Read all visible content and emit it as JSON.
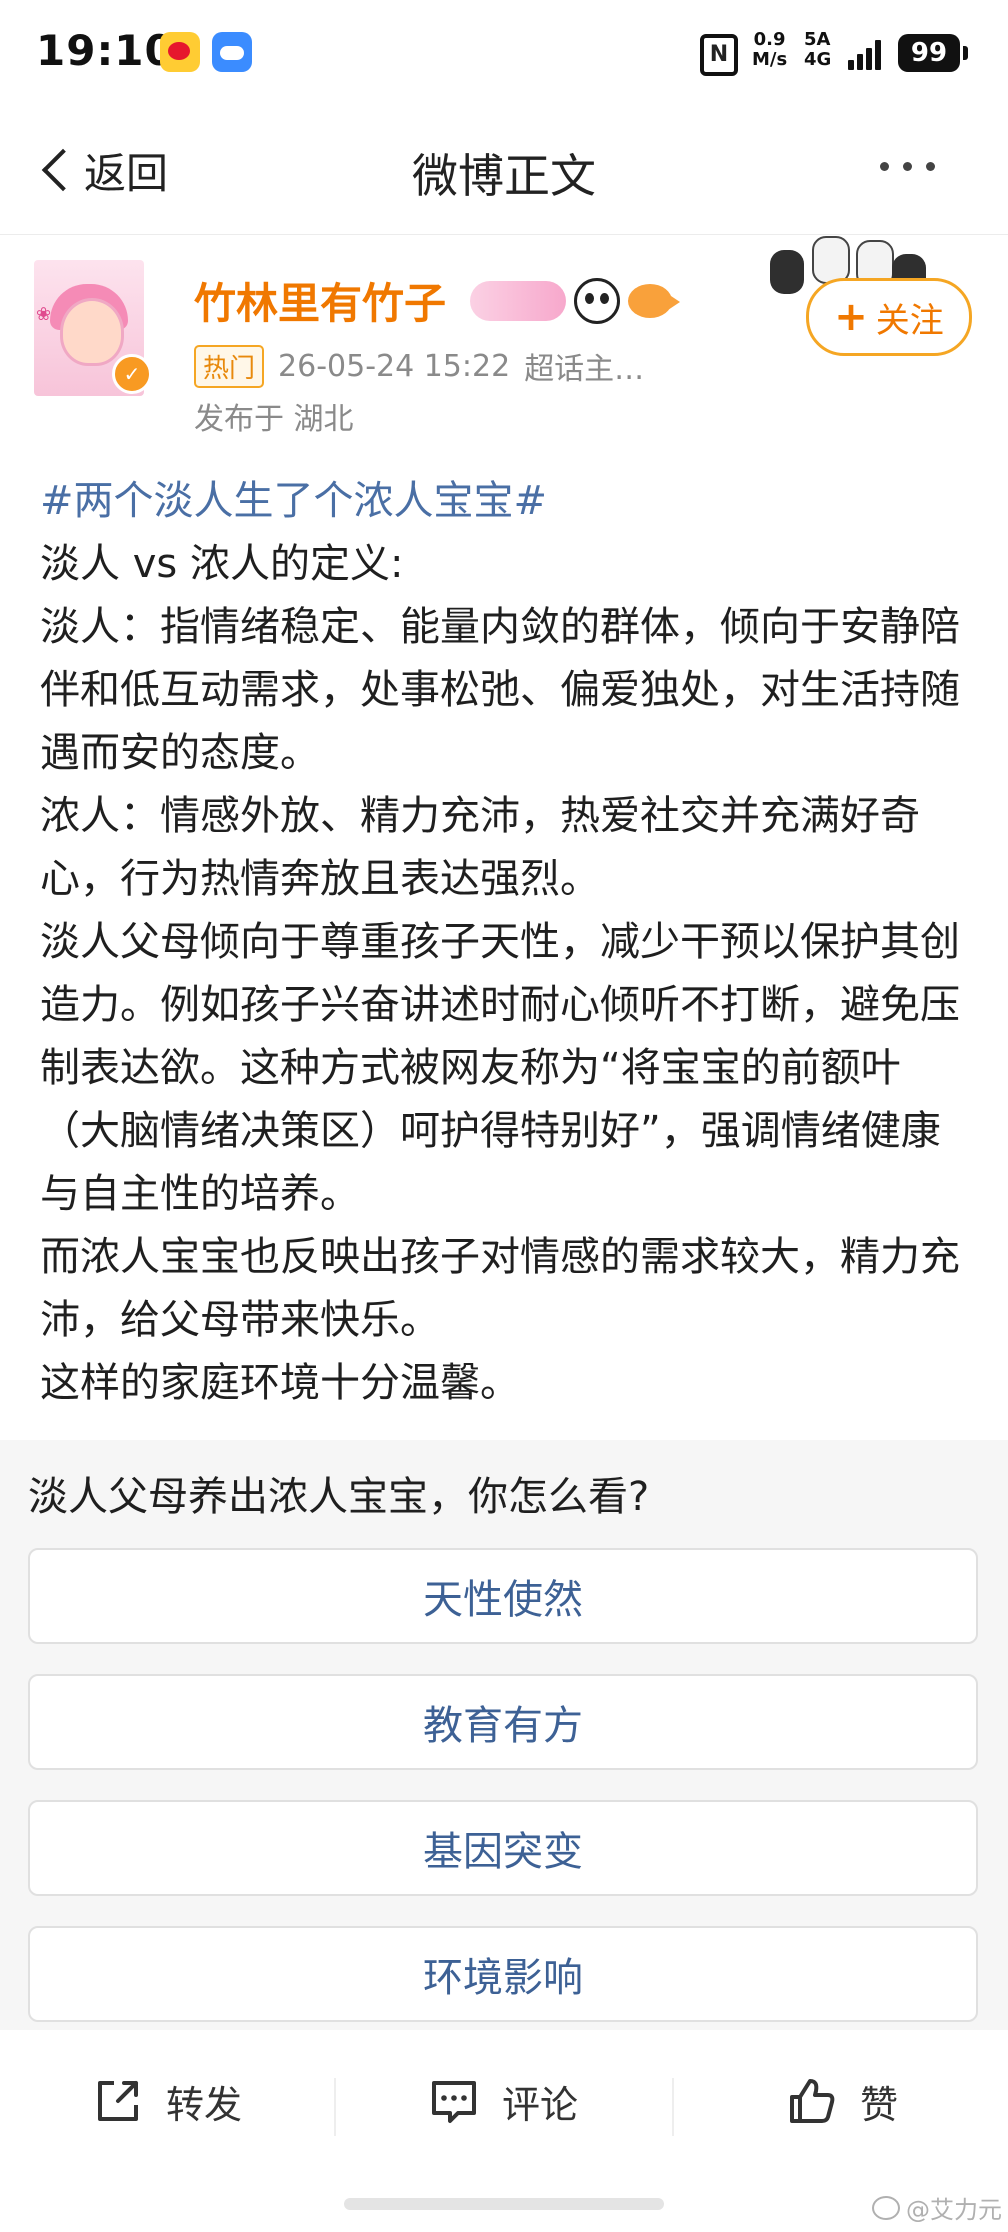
{
  "status_bar": {
    "time": "19:10",
    "net_speed_value": "0.9",
    "net_speed_unit": "M/s",
    "net_type_top": "5A",
    "net_type_bottom": "4G",
    "battery": "99",
    "nfc": "N"
  },
  "nav": {
    "back_label": "返回",
    "title": "微博正文"
  },
  "post": {
    "username": "竹林里有竹子",
    "hot_tag": "热门",
    "time": "26-05-24 15:22",
    "source": "超话主…",
    "location": "发布于 湖北",
    "follow_label": "关注",
    "follow_plus": "+",
    "verified_mark": "✓",
    "hashtag": "#两个淡人生了个浓人宝宝#",
    "paragraphs": [
      "淡人 vs 浓人的定义:",
      "淡人：指情绪稳定、能量内敛的群体，倾向于安静陪伴和低互动需求，处事松弛、偏爱独处，对生活持随遇而安的态度。",
      "浓人：情感外放、精力充沛，热爱社交并充满好奇心，行为热情奔放且表达强烈。",
      "淡人父母倾向于尊重孩子天性，减少干预以保护其创造力。例如孩子兴奋讲述时耐心倾听不打断，避免压制表达欲。这种方式被网友称为“将宝宝的前额叶（大脑情绪决策区）呵护得特别好”，强调情绪健康与自主性的培养。",
      "而浓人宝宝也反映出孩子对情感的需求较大，精力充沛，给父母带来快乐。",
      "这样的家庭环境十分温馨。"
    ]
  },
  "poll": {
    "question": "淡人父母养出浓人宝宝，你怎么看?",
    "options": [
      "天性使然",
      "教育有方",
      "基因突变",
      "环境影响"
    ]
  },
  "bottom_bar": {
    "repost_label": "转发",
    "comment_label": "评论",
    "like_label": "赞"
  },
  "watermark": "@艾力元"
}
